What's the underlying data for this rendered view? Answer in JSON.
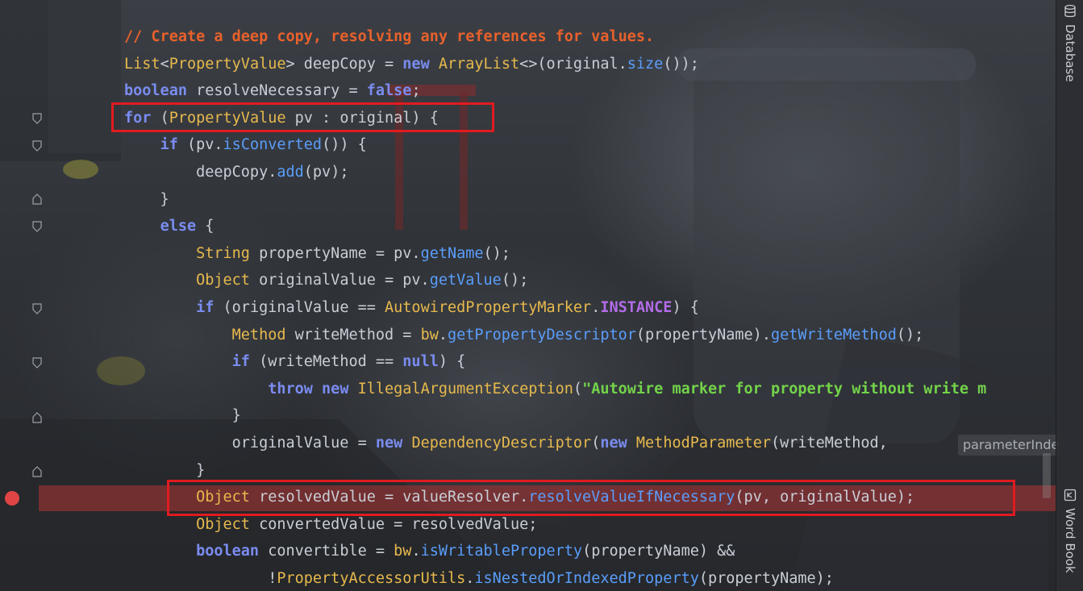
{
  "editor": {
    "lines": [
      {
        "parts": [
          {
            "t": "// Create a deep copy, resolving any references for values.",
            "c": "cm"
          }
        ]
      },
      {
        "parts": [
          {
            "t": "List",
            "c": "ty"
          },
          {
            "t": "<",
            "c": "pl"
          },
          {
            "t": "PropertyValue",
            "c": "ty"
          },
          {
            "t": "> deepCopy = ",
            "c": "pl"
          },
          {
            "t": "new ",
            "c": "kw"
          },
          {
            "t": "ArrayList",
            "c": "ty"
          },
          {
            "t": "<>(original.",
            "c": "pl"
          },
          {
            "t": "size",
            "c": "mt"
          },
          {
            "t": "());",
            "c": "pl"
          }
        ]
      },
      {
        "parts": [
          {
            "t": "boolean ",
            "c": "kw"
          },
          {
            "t": "resolveNecessary = ",
            "c": "pl"
          },
          {
            "t": "false",
            "c": "kw"
          },
          {
            "t": ";",
            "c": "pl"
          }
        ]
      },
      {
        "parts": [
          {
            "t": "for ",
            "c": "kw"
          },
          {
            "t": "(",
            "c": "pl"
          },
          {
            "t": "PropertyValue",
            "c": "ty"
          },
          {
            "t": " pv : original) {",
            "c": "pl"
          }
        ]
      },
      {
        "parts": [
          {
            "t": "    ",
            "c": "pl"
          },
          {
            "t": "if ",
            "c": "kw"
          },
          {
            "t": "(pv.",
            "c": "pl"
          },
          {
            "t": "isConverted",
            "c": "mt"
          },
          {
            "t": "()) {",
            "c": "pl"
          }
        ]
      },
      {
        "parts": [
          {
            "t": "        deepCopy.",
            "c": "pl"
          },
          {
            "t": "add",
            "c": "mt"
          },
          {
            "t": "(pv);",
            "c": "pl"
          }
        ]
      },
      {
        "parts": [
          {
            "t": "    }",
            "c": "pl"
          }
        ]
      },
      {
        "parts": [
          {
            "t": "    ",
            "c": "pl"
          },
          {
            "t": "else ",
            "c": "kw"
          },
          {
            "t": "{",
            "c": "pl"
          }
        ]
      },
      {
        "parts": [
          {
            "t": "        ",
            "c": "pl"
          },
          {
            "t": "String",
            "c": "ty"
          },
          {
            "t": " propertyName = pv.",
            "c": "pl"
          },
          {
            "t": "getName",
            "c": "mt"
          },
          {
            "t": "();",
            "c": "pl"
          }
        ]
      },
      {
        "parts": [
          {
            "t": "        ",
            "c": "pl"
          },
          {
            "t": "Object",
            "c": "ty"
          },
          {
            "t": " originalValue = pv.",
            "c": "pl"
          },
          {
            "t": "getValue",
            "c": "mt"
          },
          {
            "t": "();",
            "c": "pl"
          }
        ]
      },
      {
        "parts": [
          {
            "t": "        ",
            "c": "pl"
          },
          {
            "t": "if ",
            "c": "kw"
          },
          {
            "t": "(originalValue == ",
            "c": "pl"
          },
          {
            "t": "AutowiredPropertyMarker",
            "c": "ty"
          },
          {
            "t": ".",
            "c": "pl"
          },
          {
            "t": "INSTANCE",
            "c": "cs"
          },
          {
            "t": ") {",
            "c": "pl"
          }
        ]
      },
      {
        "parts": [
          {
            "t": "            ",
            "c": "pl"
          },
          {
            "t": "Method",
            "c": "ty"
          },
          {
            "t": " writeMethod = ",
            "c": "pl"
          },
          {
            "t": "bw",
            "c": "ty"
          },
          {
            "t": ".",
            "c": "pl"
          },
          {
            "t": "getPropertyDescriptor",
            "c": "mt"
          },
          {
            "t": "(propertyName).",
            "c": "pl"
          },
          {
            "t": "getWriteMethod",
            "c": "mt"
          },
          {
            "t": "();",
            "c": "pl"
          }
        ]
      },
      {
        "parts": [
          {
            "t": "            ",
            "c": "pl"
          },
          {
            "t": "if ",
            "c": "kw"
          },
          {
            "t": "(writeMethod == ",
            "c": "pl"
          },
          {
            "t": "null",
            "c": "kw"
          },
          {
            "t": ") {",
            "c": "pl"
          }
        ]
      },
      {
        "parts": [
          {
            "t": "                ",
            "c": "pl"
          },
          {
            "t": "throw new ",
            "c": "kw"
          },
          {
            "t": "IllegalArgumentException",
            "c": "ty"
          },
          {
            "t": "(",
            "c": "pl"
          },
          {
            "t": "\"Autowire marker for property without write m",
            "c": "st"
          }
        ]
      },
      {
        "parts": [
          {
            "t": "            }",
            "c": "pl"
          }
        ]
      },
      {
        "parts": [
          {
            "t": "            originalValue = ",
            "c": "pl"
          },
          {
            "t": "new ",
            "c": "kw"
          },
          {
            "t": "DependencyDescriptor",
            "c": "ty"
          },
          {
            "t": "(",
            "c": "pl"
          },
          {
            "t": "new ",
            "c": "kw"
          },
          {
            "t": "MethodParameter",
            "c": "ty"
          },
          {
            "t": "(writeMethod, ",
            "c": "pl"
          }
        ]
      },
      {
        "parts": [
          {
            "t": "        }",
            "c": "pl"
          }
        ]
      },
      {
        "parts": [
          {
            "t": "        ",
            "c": "pl"
          },
          {
            "t": "Object",
            "c": "ty"
          },
          {
            "t": " resolvedValue = valueResolver.",
            "c": "pl"
          },
          {
            "t": "resolveValueIfNecessary",
            "c": "mt"
          },
          {
            "t": "(pv, originalValue);",
            "c": "pl"
          }
        ]
      },
      {
        "parts": [
          {
            "t": "        ",
            "c": "pl"
          },
          {
            "t": "Object",
            "c": "ty"
          },
          {
            "t": " convertedValue = resolvedValue;",
            "c": "pl"
          }
        ]
      },
      {
        "parts": [
          {
            "t": "        ",
            "c": "pl"
          },
          {
            "t": "boolean ",
            "c": "kw"
          },
          {
            "t": "convertible = ",
            "c": "pl"
          },
          {
            "t": "bw",
            "c": "ty"
          },
          {
            "t": ".",
            "c": "pl"
          },
          {
            "t": "isWritableProperty",
            "c": "mt"
          },
          {
            "t": "(propertyName) &&",
            "c": "pl"
          }
        ]
      },
      {
        "parts": [
          {
            "t": "                !",
            "c": "pl"
          },
          {
            "t": "PropertyAccessorUtils",
            "c": "ty"
          },
          {
            "t": ".",
            "c": "pl"
          },
          {
            "t": "isNestedOrIndexedProperty",
            "c": "mt"
          },
          {
            "t": "(propertyName);",
            "c": "pl"
          }
        ]
      }
    ],
    "param_hint": "parameterIndex",
    "breakpoint_line": 18
  },
  "tool_windows": [
    {
      "label": "Database",
      "icon": "database-icon"
    },
    {
      "label": "Word Book",
      "icon": "word-book-icon"
    }
  ],
  "colors": {
    "keyword": "#7a8cf0",
    "type": "#e7b94d",
    "method": "#5a9dfa",
    "comment": "#e8612b",
    "string": "#73d34a",
    "constant": "#b36ce8",
    "plain": "#c9ced6",
    "highlight_box": "#e01b20",
    "breakpoint": "#e04545"
  }
}
